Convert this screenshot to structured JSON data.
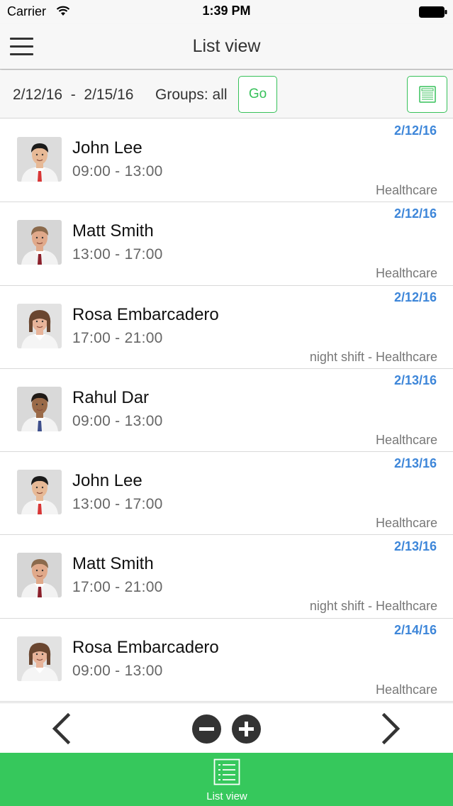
{
  "status_bar": {
    "carrier": "Carrier",
    "time": "1:39 PM",
    "wifi_icon": "wifi-icon",
    "battery_icon": "battery-icon"
  },
  "nav": {
    "title": "List view",
    "menu_icon": "hamburger-menu-icon"
  },
  "filter": {
    "date_range": "2/12/16  -  2/15/16",
    "groups": "Groups: all",
    "go_label": "Go",
    "export_icon": "list-document-icon"
  },
  "shifts": [
    {
      "name": "John Lee",
      "time": "09:00 - 13:00",
      "date": "2/12/16",
      "group": "Healthcare",
      "avatar": "john"
    },
    {
      "name": "Matt Smith",
      "time": "13:00 - 17:00",
      "date": "2/12/16",
      "group": "Healthcare",
      "avatar": "matt"
    },
    {
      "name": "Rosa Embarcadero",
      "time": "17:00 - 21:00",
      "date": "2/12/16",
      "group": "night shift - Healthcare",
      "avatar": "rosa"
    },
    {
      "name": "Rahul Dar",
      "time": "09:00 - 13:00",
      "date": "2/13/16",
      "group": "Healthcare",
      "avatar": "rahul"
    },
    {
      "name": "John Lee",
      "time": "13:00 - 17:00",
      "date": "2/13/16",
      "group": "Healthcare",
      "avatar": "john"
    },
    {
      "name": "Matt Smith",
      "time": "17:00 - 21:00",
      "date": "2/13/16",
      "group": "night shift - Healthcare",
      "avatar": "matt"
    },
    {
      "name": "Rosa Embarcadero",
      "time": "09:00 - 13:00",
      "date": "2/14/16",
      "group": "Healthcare",
      "avatar": "rosa"
    }
  ],
  "pager": {
    "prev_icon": "chevron-left-icon",
    "next_icon": "chevron-right-icon",
    "zoom_out_icon": "minus-circle-icon",
    "zoom_in_icon": "plus-circle-icon"
  },
  "tab_bar": {
    "tabs": [
      {
        "label": "List view",
        "icon": "list-view-icon",
        "active": true
      }
    ]
  },
  "colors": {
    "accent_green": "#36c85c",
    "date_blue": "#3d86d9",
    "go_border": "#37c15a"
  }
}
